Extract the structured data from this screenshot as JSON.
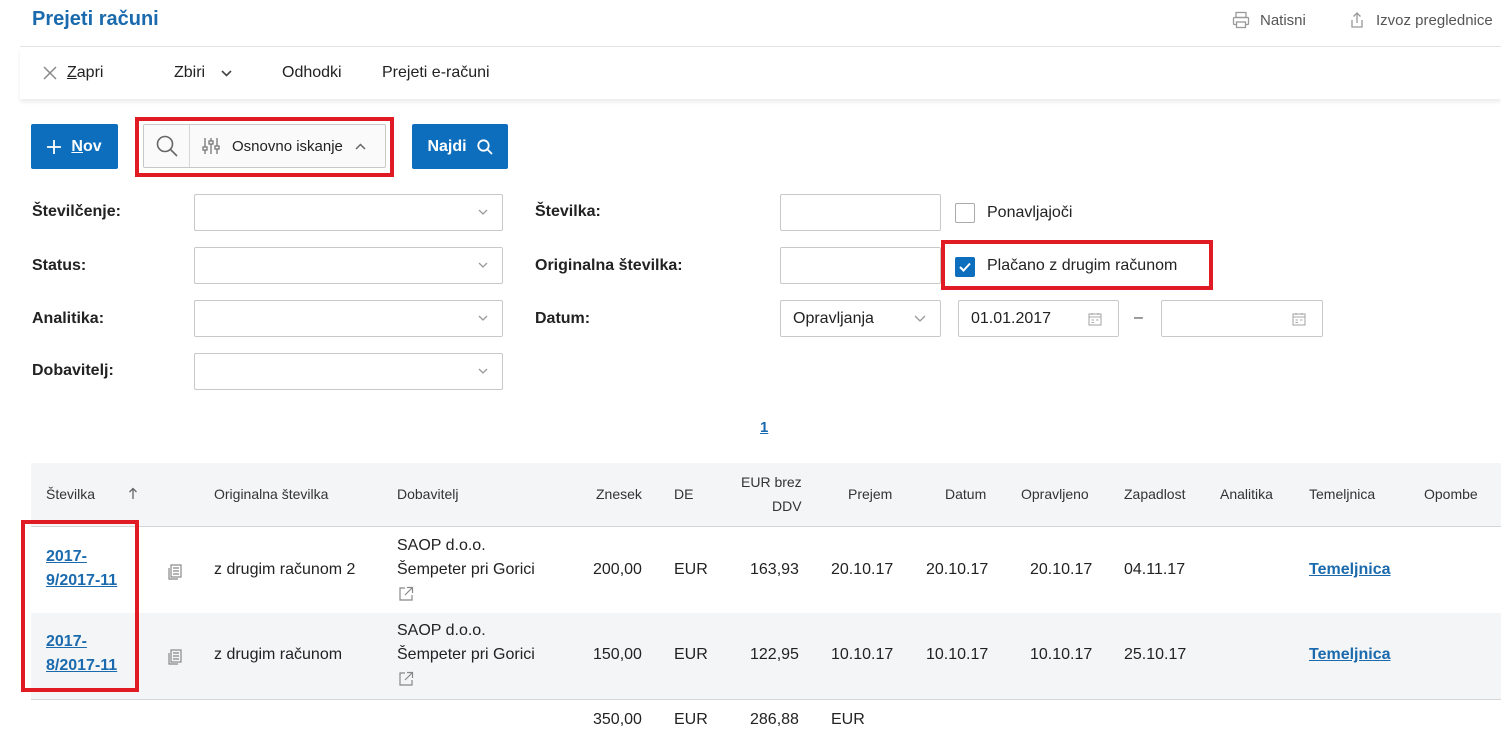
{
  "header": {
    "title": "Prejeti računi",
    "print_label": "Natisni",
    "export_label": "Izvoz preglednice"
  },
  "toolbar": {
    "close_label": "Zapri",
    "close_accel": "Z",
    "close_rest": "apri",
    "collections_label": "Zbiri",
    "deductions_label": "Odhodki",
    "einvoices_label": "Prejeti e-računi"
  },
  "actions": {
    "new_accel": "N",
    "new_rest": "ov",
    "search_mode_label": "Osnovno iskanje",
    "find_label": "Najdi"
  },
  "filters": {
    "numbering_label": "Številčenje:",
    "status_label": "Status:",
    "analytics_label": "Analitika:",
    "supplier_label": "Dobavitelj:",
    "number_label": "Številka:",
    "original_number_label": "Originalna številka:",
    "date_label": "Datum:",
    "recurring_label": "Ponavljajoči",
    "recurring_checked": false,
    "paid_other_label": "Plačano z drugim računom",
    "paid_other_checked": true,
    "date_type_value": "Opravljanja",
    "date_from_value": "01.01.2017",
    "date_to_value": "",
    "date_separator": "–"
  },
  "pager": {
    "current_page": "1"
  },
  "table": {
    "columns": {
      "number": "Številka",
      "original_number": "Originalna številka",
      "supplier": "Dobavitelj",
      "amount": "Znesek",
      "currency": "DE",
      "eur_net_line1": "EUR brez",
      "eur_net_line2": "DDV",
      "received": "Prejem",
      "date": "Datum",
      "performed": "Opravljeno",
      "due": "Zapadlost",
      "analytics": "Analitika",
      "journal": "Temeljnica",
      "notes": "Opombe"
    },
    "rows": [
      {
        "number_line1": "2017-",
        "number_line2": "9/2017-11",
        "original_number": "z drugim računom 2",
        "supplier_line1": "SAOP d.o.o.",
        "supplier_line2": "Šempeter pri Gorici",
        "amount": "200,00",
        "currency": "EUR",
        "eur_net": "163,93",
        "received": "20.10.17",
        "date": "20.10.17",
        "performed": "20.10.17",
        "due": "04.11.17",
        "analytics": "",
        "journal": "Temeljnica",
        "notes": ""
      },
      {
        "number_line1": "2017-",
        "number_line2": "8/2017-11",
        "original_number": "z drugim računom",
        "supplier_line1": "SAOP d.o.o.",
        "supplier_line2": "Šempeter pri Gorici",
        "amount": "150,00",
        "currency": "EUR",
        "eur_net": "122,95",
        "received": "10.10.17",
        "date": "10.10.17",
        "performed": "10.10.17",
        "due": "25.10.17",
        "analytics": "",
        "journal": "Temeljnica",
        "notes": ""
      }
    ],
    "totals": {
      "amount": "350,00",
      "currency": "EUR",
      "eur_net": "286,88",
      "eur_net_currency": "EUR"
    }
  },
  "colors": {
    "accent": "#0d6ebd",
    "title": "#1a6aad",
    "highlight_frame": "#e01b24"
  }
}
